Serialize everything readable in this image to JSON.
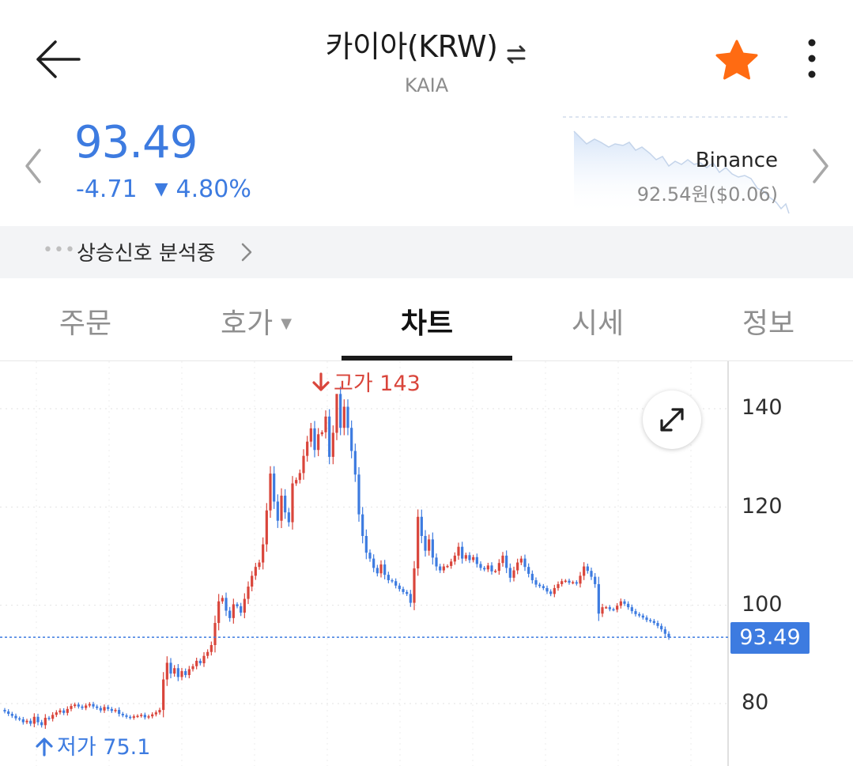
{
  "header": {
    "title": "카이아(KRW)",
    "ticker": "KAIA",
    "favorite_color": "#ff6b12"
  },
  "price": {
    "current": "93.49",
    "change_amount": "-4.71",
    "change_direction": "▼",
    "change_percent": "4.80%",
    "color": "#3d7be0"
  },
  "exchange_compare": {
    "name": "Binance",
    "price": "92.54원($0.06)"
  },
  "signal": {
    "dots": "•••",
    "text": "상승신호 분석중"
  },
  "tabs": [
    {
      "label": "주문"
    },
    {
      "label": "호가",
      "dropdown": "▼"
    },
    {
      "label": "차트",
      "active": true
    },
    {
      "label": "시세"
    },
    {
      "label": "정보"
    }
  ],
  "chart_data": {
    "type": "candlestick",
    "y_ticks": [
      "140",
      "120",
      "100",
      "80"
    ],
    "y_range": [
      70,
      146
    ],
    "last_price": "93.49",
    "high_label": "고가 143",
    "low_label": "저가 75.1",
    "high_value": 143,
    "low_value": 75.1,
    "up_color": "#d9453b",
    "down_color": "#3d7be0",
    "closes": [
      78.4,
      77.9,
      77.5,
      77.0,
      76.8,
      76.2,
      76.5,
      75.9,
      77.3,
      76.2,
      75.6,
      77.1,
      76.9,
      77.7,
      78.2,
      78.6,
      78.1,
      78.9,
      79.5,
      79.8,
      79.4,
      79.1,
      79.6,
      79.9,
      79.4,
      79.1,
      78.6,
      79.3,
      78.9,
      78.5,
      78.7,
      77.9,
      77.6,
      77.3,
      77.1,
      77.4,
      77.5,
      77.7,
      77.2,
      77.4,
      77.8,
      78.2,
      78.7,
      84.9,
      88.3,
      86.1,
      87.2,
      85.4,
      86.6,
      85.8,
      87.0,
      87.6,
      88.7,
      88.2,
      89.7,
      90.5,
      91.9,
      96.4,
      100.8,
      101.5,
      98.9,
      97.4,
      100.2,
      99.8,
      98.5,
      101.3,
      103.8,
      106.0,
      107.8,
      108.7,
      112.4,
      119.3,
      126.8,
      121.1,
      117.2,
      122.3,
      118.9,
      116.9,
      124.8,
      125.5,
      126.9,
      130.4,
      133.3,
      136.0,
      131.6,
      134.8,
      135.2,
      138.4,
      130.2,
      135.1,
      143.0,
      136.1,
      140.4,
      136.1,
      131.4,
      126.6,
      118.5,
      114.1,
      110.7,
      109.5,
      107.6,
      106.5,
      108.3,
      106.2,
      105.1,
      104.9,
      104.0,
      103.3,
      102.7,
      102.3,
      100.5,
      107.5,
      118.0,
      114.1,
      111.1,
      113.4,
      109.7,
      107.9,
      107.1,
      107.9,
      108.0,
      108.9,
      110.1,
      111.9,
      109.5,
      110.2,
      109.2,
      109.8,
      108.4,
      107.6,
      107.3,
      108.1,
      106.9,
      107.0,
      108.6,
      110.1,
      107.6,
      105.6,
      107.1,
      108.7,
      109.5,
      107.8,
      106.4,
      105.1,
      104.2,
      103.9,
      103.5,
      102.8,
      102.3,
      103.5,
      104.3,
      104.9,
      105.0,
      104.6,
      104.7,
      104.4,
      106.0,
      107.9,
      107.0,
      105.8,
      104.3,
      98.3,
      99.6,
      99.6,
      99.2,
      99.1,
      99.9,
      100.8,
      100.3,
      99.6,
      98.8,
      98.2,
      97.9,
      97.5,
      97.0,
      96.8,
      96.4,
      95.8,
      95.1,
      94.2,
      93.49
    ]
  }
}
